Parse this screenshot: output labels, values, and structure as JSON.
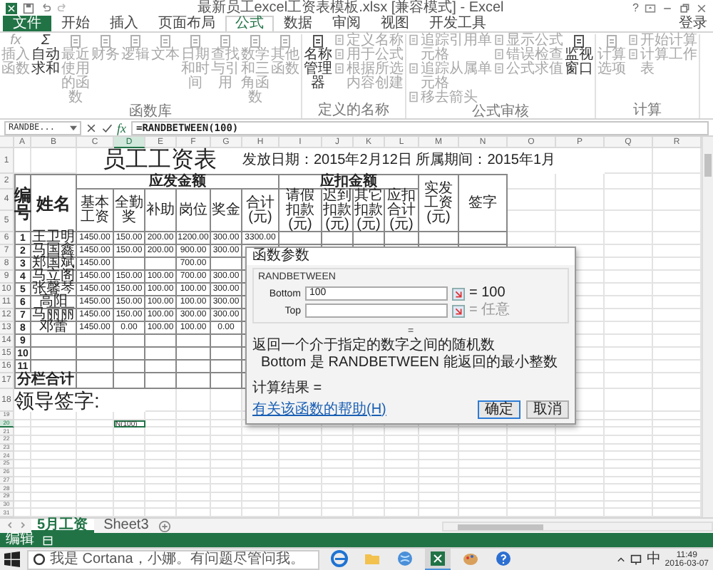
{
  "title_bar": {
    "title": "最新员工excel工资表模板.xlsx [兼容模式] - Excel",
    "help": "?",
    "account": "登录"
  },
  "ribbon_tabs": [
    {
      "label": "文件",
      "kind": "file",
      "selected": false
    },
    {
      "label": "开始",
      "kind": "tab",
      "selected": false
    },
    {
      "label": "插入",
      "kind": "tab",
      "selected": false
    },
    {
      "label": "页面布局",
      "kind": "tab",
      "selected": false
    },
    {
      "label": "公式",
      "kind": "tab",
      "selected": true
    },
    {
      "label": "数据",
      "kind": "tab",
      "selected": false
    },
    {
      "label": "审阅",
      "kind": "tab",
      "selected": false
    },
    {
      "label": "视图",
      "kind": "tab",
      "selected": false
    },
    {
      "label": "开发工具",
      "kind": "tab",
      "selected": false
    }
  ],
  "ribbon_groups": [
    {
      "label": "函数库",
      "items": [
        {
          "kind": "large",
          "label": "插入函数",
          "glyph": "fx",
          "disabled": true
        },
        {
          "kind": "large",
          "label": "自动求和",
          "glyph": "Σ",
          "disabled": false
        },
        {
          "kind": "large",
          "label": "最近使用的函数",
          "disabled": true
        },
        {
          "kind": "large",
          "label": "财务",
          "disabled": true
        },
        {
          "kind": "large",
          "label": "逻辑",
          "disabled": true
        },
        {
          "kind": "large",
          "label": "文本",
          "disabled": true
        },
        {
          "kind": "large",
          "label": "日期和时间",
          "disabled": true
        },
        {
          "kind": "large",
          "label": "查找与引用",
          "disabled": true
        },
        {
          "kind": "large",
          "label": "数学和三角函数",
          "disabled": true
        },
        {
          "kind": "large",
          "label": "其他函数",
          "disabled": true
        }
      ]
    },
    {
      "label": "定义的名称",
      "items": [
        {
          "kind": "large",
          "label": "名称管理器",
          "disabled": false
        },
        {
          "kind": "small",
          "label": "定义名称",
          "disabled": true
        },
        {
          "kind": "small",
          "label": "用于公式",
          "disabled": true
        },
        {
          "kind": "small",
          "label": "根据所选内容创建",
          "disabled": true
        }
      ]
    },
    {
      "label": "公式审核",
      "items": [
        {
          "kind": "small",
          "label": "追踪引用单元格",
          "disabled": true
        },
        {
          "kind": "small",
          "label": "追踪从属单元格",
          "disabled": true
        },
        {
          "kind": "small",
          "label": "移去箭头",
          "disabled": true
        },
        {
          "kind": "small",
          "label": "显示公式",
          "disabled": true
        },
        {
          "kind": "small",
          "label": "错误检查",
          "disabled": true
        },
        {
          "kind": "small",
          "label": "公式求值",
          "disabled": true
        },
        {
          "kind": "large",
          "label": "监视窗口",
          "disabled": false
        }
      ]
    },
    {
      "label": "计算",
      "items": [
        {
          "kind": "large",
          "label": "计算选项",
          "disabled": true
        },
        {
          "kind": "small",
          "label": "开始计算",
          "disabled": true
        },
        {
          "kind": "small",
          "label": "计算工作表",
          "disabled": true
        }
      ]
    }
  ],
  "formula_bar": {
    "name_box": "RANDBE...",
    "fx": "fx",
    "formula": "=RANDBETWEEN(100)"
  },
  "sheet": {
    "columns": [
      {
        "label": "A",
        "selected": false
      },
      {
        "label": "B",
        "selected": false
      },
      {
        "label": "C",
        "selected": false
      },
      {
        "label": "D",
        "selected": true
      },
      {
        "label": "E",
        "selected": false
      },
      {
        "label": "F",
        "selected": false
      },
      {
        "label": "G",
        "selected": false
      },
      {
        "label": "H",
        "selected": false
      },
      {
        "label": "I",
        "selected": false
      },
      {
        "label": "J",
        "selected": false
      },
      {
        "label": "K",
        "selected": false
      },
      {
        "label": "L",
        "selected": false
      },
      {
        "label": "M",
        "selected": false
      },
      {
        "label": "N",
        "selected": false
      },
      {
        "label": "O",
        "selected": false
      },
      {
        "label": "P",
        "selected": false
      },
      {
        "label": "Q",
        "selected": false
      },
      {
        "label": "R",
        "selected": false
      }
    ],
    "rows": [
      {
        "label": "1",
        "selected": false
      },
      {
        "label": "2",
        "selected": false
      },
      {
        "label": "4",
        "selected": false
      },
      {
        "label": "5",
        "selected": false
      },
      {
        "label": "6",
        "selected": false
      },
      {
        "label": "7",
        "selected": false
      },
      {
        "label": "8",
        "selected": false
      },
      {
        "label": "9",
        "selected": false
      },
      {
        "label": "10",
        "selected": false
      },
      {
        "label": "11",
        "selected": false
      },
      {
        "label": "12",
        "selected": false
      },
      {
        "label": "13",
        "selected": false
      },
      {
        "label": "14",
        "selected": false
      },
      {
        "label": "15",
        "selected": false
      },
      {
        "label": "16",
        "selected": false
      },
      {
        "label": "17",
        "selected": false
      },
      {
        "label": "18",
        "selected": false
      },
      {
        "label": "19",
        "selected": false
      },
      {
        "label": "20",
        "selected": true
      },
      {
        "label": "21",
        "selected": false
      },
      {
        "label": "22",
        "selected": false
      },
      {
        "label": "23",
        "selected": false
      },
      {
        "label": "24",
        "selected": false
      },
      {
        "label": "25",
        "selected": false
      },
      {
        "label": "26",
        "selected": false
      },
      {
        "label": "27",
        "selected": false
      },
      {
        "label": "28",
        "selected": false
      },
      {
        "label": "29",
        "selected": false
      },
      {
        "label": "30",
        "selected": false
      },
      {
        "label": "31",
        "selected": false
      }
    ],
    "title": "员工工资表",
    "issue_info": "发放日期：2015年2月12日  所属期间：2015年1月",
    "header_groups": [
      {
        "label": "编号"
      },
      {
        "label": "姓名"
      },
      {
        "label": "应发金额",
        "columns": [
          "基本工资",
          "全勤奖",
          "补助",
          "岗位",
          "奖金",
          "合计(元)"
        ]
      },
      {
        "label": "应扣金额",
        "columns": [
          "请假扣款(元)",
          "迟到扣款(元)",
          "其它扣款(元)",
          "应扣合计(元)"
        ]
      },
      {
        "label": "实发工资(元)"
      },
      {
        "label": "签字"
      }
    ],
    "records": [
      {
        "no": "1",
        "name": "王卫明",
        "amounts": {
          "basic": "1450.00",
          "attendance": "150.00",
          "subsidy": "200.00",
          "post": "1200.00",
          "bonus": "300.00",
          "total": "3300.00"
        }
      },
      {
        "no": "2",
        "name": "马国鑫",
        "amounts": {
          "basic": "1450.00",
          "attendance": "150.00",
          "subsidy": "200.00",
          "post": "900.00",
          "bonus": "300.00"
        }
      },
      {
        "no": "3",
        "name": "郑国斌",
        "amounts": {
          "basic": "1450.00",
          "post": "700.00"
        }
      },
      {
        "no": "4",
        "name": "马立阁",
        "amounts": {
          "basic": "1450.00",
          "attendance": "150.00",
          "subsidy": "100.00",
          "post": "700.00",
          "bonus": "300.00"
        }
      },
      {
        "no": "5",
        "name": "张馨琴",
        "amounts": {
          "basic": "1450.00",
          "attendance": "150.00",
          "subsidy": "100.00",
          "post": "100.00",
          "bonus": "300.00"
        }
      },
      {
        "no": "6",
        "name": "高阳",
        "amounts": {
          "basic": "1450.00",
          "attendance": "150.00",
          "subsidy": "100.00",
          "post": "100.00",
          "bonus": "300.00"
        }
      },
      {
        "no": "7",
        "name": "马丽丽",
        "amounts": {
          "basic": "1450.00",
          "attendance": "150.00",
          "subsidy": "100.00",
          "post": "300.00",
          "bonus": "300.00"
        }
      },
      {
        "no": "8",
        "name": "邓蕾",
        "amounts": {
          "basic": "1450.00",
          "attendance": "0.00",
          "subsidy": "100.00",
          "post": "100.00",
          "bonus": "0.00"
        }
      },
      {
        "no": "9"
      },
      {
        "no": "10"
      },
      {
        "no": "11"
      }
    ],
    "subtotal_label": "分栏合计",
    "signature_label": "领导签字:",
    "active_cell_text": "N(100)"
  },
  "dialog": {
    "title": "函数参数",
    "function": "RANDBETWEEN",
    "args": [
      {
        "name": "Bottom",
        "value": "100",
        "result": "= 100"
      },
      {
        "name": "Top",
        "result": "= 任意"
      }
    ],
    "equals": "=",
    "description": "返回一个介于指定的数字之间的随机数",
    "arg_help": "Bottom  是 RANDBETWEEN 能返回的最小整数",
    "result_label": "计算结果 =",
    "help_link": "有关该函数的帮助(H)",
    "buttons": [
      {
        "label": "确定",
        "selected": true
      },
      {
        "label": "取消",
        "selected": false
      }
    ]
  },
  "sheet_tabs": [
    {
      "label": "5月工资",
      "selected": true
    },
    {
      "label": "Sheet3",
      "selected": false
    }
  ],
  "status_bar": {
    "mode": "编辑"
  },
  "taskbar": {
    "search": "我是 Cortana，小娜。有问题尽管问我。",
    "apps": [
      {
        "kind": "edge",
        "active": false
      },
      {
        "kind": "folder",
        "active": false
      },
      {
        "kind": "globe",
        "active": false
      },
      {
        "kind": "excel",
        "active": true
      },
      {
        "kind": "paint",
        "active": false
      },
      {
        "kind": "help",
        "active": false
      }
    ],
    "ime": "中",
    "time": "11:49",
    "date": "2016-03-07"
  }
}
